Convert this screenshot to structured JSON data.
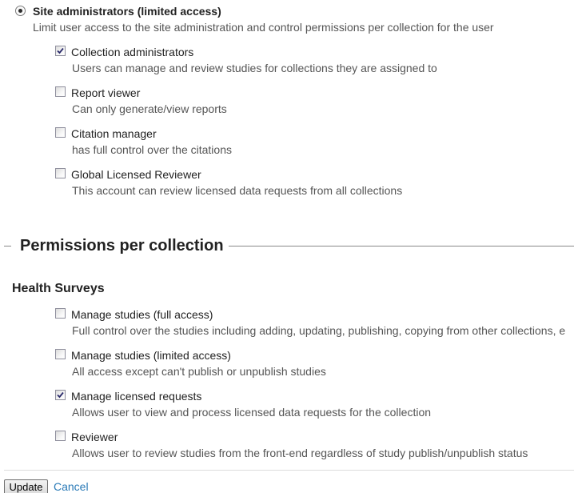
{
  "site_admin": {
    "title": "Site administrators (limited access)",
    "description": "Limit user access to the site administration and control permissions per collection for the user",
    "selected": true,
    "options": [
      {
        "label": "Collection administrators",
        "description": "Users can manage and review studies for collections they are assigned to",
        "checked": true
      },
      {
        "label": "Report viewer",
        "description": "Can only generate/view reports",
        "checked": false
      },
      {
        "label": "Citation manager",
        "description": "has full control over the citations",
        "checked": false
      },
      {
        "label": "Global Licensed Reviewer",
        "description": "This account can review licensed data requests from all collections",
        "checked": false
      }
    ]
  },
  "permissions": {
    "heading": "Permissions per collection",
    "collection_name": "Health Surveys",
    "options": [
      {
        "label": "Manage studies (full access)",
        "description": "Full control over the studies including adding, updating, publishing, copying from other collections, e",
        "checked": false
      },
      {
        "label": "Manage studies (limited access)",
        "description": "All access except can't publish or unpublish studies",
        "checked": false
      },
      {
        "label": "Manage licensed requests",
        "description": "Allows user to view and process licensed data requests for the collection",
        "checked": true
      },
      {
        "label": "Reviewer",
        "description": "Allows user to review studies from the front-end regardless of study publish/unpublish status",
        "checked": false
      }
    ]
  },
  "actions": {
    "update_label": "Update",
    "cancel_label": "Cancel"
  }
}
